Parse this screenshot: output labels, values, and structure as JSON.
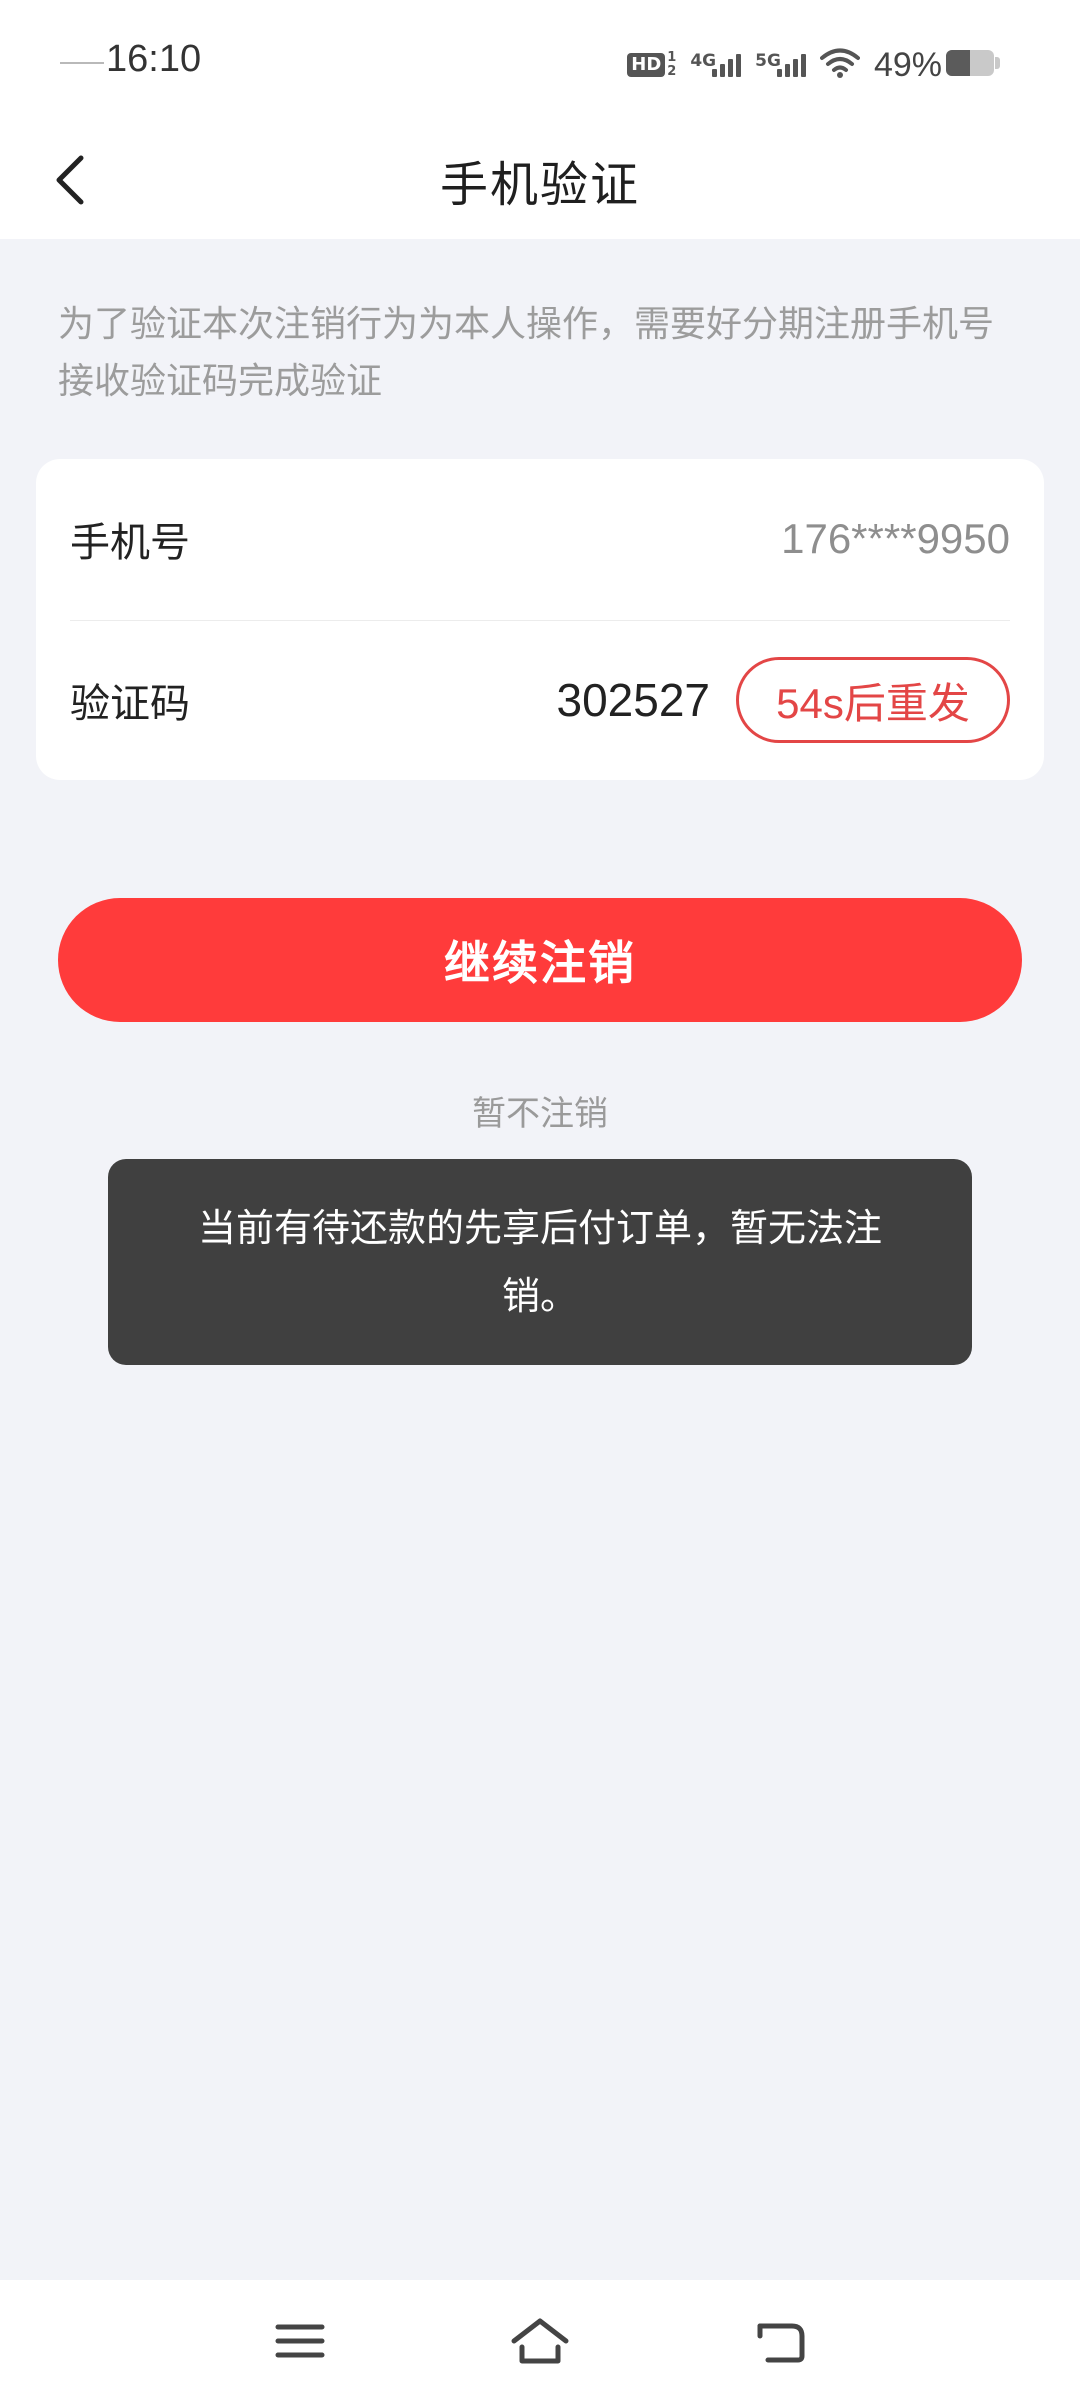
{
  "status_bar": {
    "time": "16:10",
    "hd_label": "HD",
    "hd_sub_top": "1",
    "hd_sub_bottom": "2",
    "net1_label": "4G",
    "net2_label": "5G",
    "battery_percent_text": "49%",
    "battery_level": 0.49
  },
  "header": {
    "title": "手机验证",
    "back_icon": "chevron-left-icon"
  },
  "description": "为了验证本次注销行为为本人操作，需要好分期注册手机号接收验证码完成验证",
  "form": {
    "phone_label": "手机号",
    "phone_value": "176****9950",
    "code_label": "验证码",
    "code_value": "302527",
    "resend_label": "54s后重发"
  },
  "actions": {
    "continue_label": "继续注销",
    "cancel_label": "暂不注销"
  },
  "toast": {
    "message": "当前有待还款的先享后付订单，暂无法注销。"
  },
  "nav": {
    "menu_icon": "menu-icon",
    "home_icon": "home-icon",
    "back_icon": "back-icon"
  },
  "colors": {
    "accent": "#ff3b3b",
    "resend": "#e34646",
    "background": "#f2f3f8",
    "toast_bg": "#404040"
  }
}
